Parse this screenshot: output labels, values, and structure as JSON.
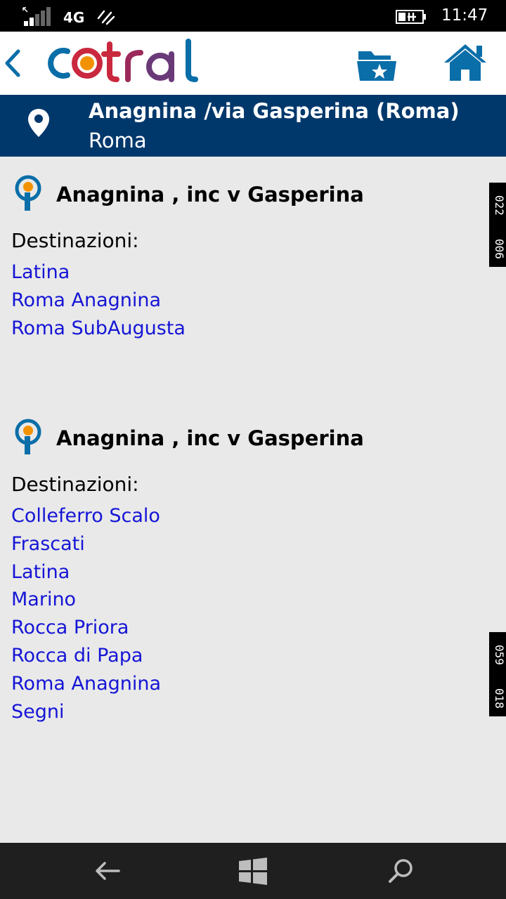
{
  "status_bar": {
    "network": "4G",
    "time": "11:47",
    "icons": [
      "signal-icon",
      "wifi-call-icon",
      "battery-charging-icon"
    ]
  },
  "header": {
    "logo_text": "cotral",
    "back_icon": "chevron-left-icon",
    "favorites_icon": "folder-star-icon",
    "home_icon": "home-icon",
    "colors": {
      "brand_blue": "#0a6ea8",
      "brand_red": "#c9283e",
      "brand_orange": "#f39200"
    }
  },
  "stop_banner": {
    "title": "Anagnina /via Gasperina (Roma)",
    "subtitle": "Roma",
    "background": "#00386c"
  },
  "sections": [
    {
      "stop_name": "Anagnina , inc v Gasperina",
      "dest_label": "Destinazioni:",
      "destinations": [
        "Latina",
        "Roma Anagnina",
        "Roma SubAugusta"
      ],
      "badge": {
        "code_a": "022",
        "code_b": "006"
      }
    },
    {
      "stop_name": "Anagnina , inc v Gasperina",
      "dest_label": "Destinazioni:",
      "destinations": [
        "Colleferro Scalo",
        "Frascati",
        "Latina",
        "Marino",
        "Rocca Priora",
        "Rocca di Papa",
        "Roma Anagnina",
        "Segni"
      ],
      "badge": {
        "code_a": "059",
        "code_b": "018"
      }
    }
  ],
  "nav_bar": {
    "icons": [
      "back-arrow-icon",
      "windows-start-icon",
      "search-icon"
    ]
  }
}
